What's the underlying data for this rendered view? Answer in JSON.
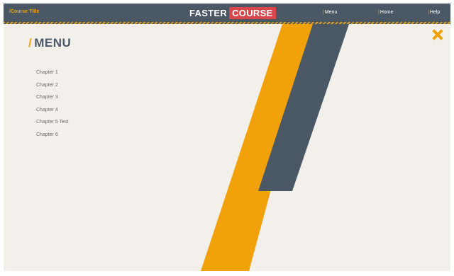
{
  "header": {
    "course_title": "/Course Title",
    "logo_left": "FASTER",
    "logo_right": "COURSE",
    "nav": [
      {
        "label": "Menu"
      },
      {
        "label": "Home"
      },
      {
        "label": "Help"
      }
    ]
  },
  "menu": {
    "slash": "/",
    "title": "MENU",
    "chapters": [
      "Chapter 1",
      "Chapter 2",
      "Chapter 3",
      "Chapter 4",
      "Chapter 5 Test",
      "Chapter 6"
    ]
  },
  "colors": {
    "header_bg": "#4a5866",
    "accent_orange": "#f1a20a",
    "logo_red": "#d9474a",
    "background": "#f3f0eb"
  },
  "icons": {
    "close": "close-icon"
  }
}
